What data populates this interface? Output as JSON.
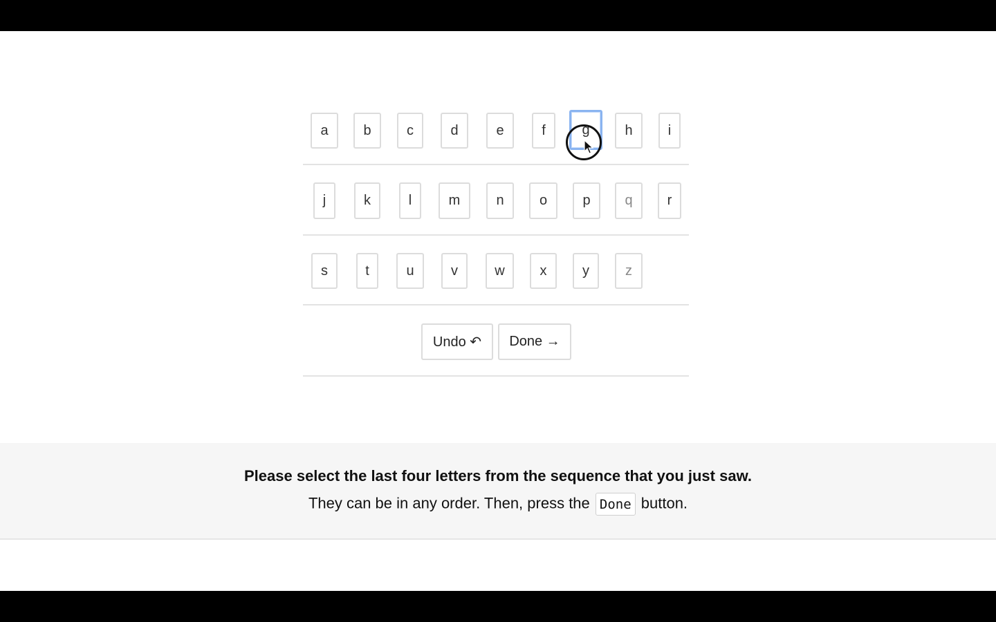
{
  "keyboard": {
    "row1": [
      "a",
      "b",
      "c",
      "d",
      "e",
      "f",
      "g",
      "h",
      "i"
    ],
    "row2": [
      "j",
      "k",
      "l",
      "m",
      "n",
      "o",
      "p",
      "q",
      "r"
    ],
    "row3": [
      "s",
      "t",
      "u",
      "v",
      "w",
      "x",
      "y",
      "z"
    ],
    "selected_key": "g"
  },
  "actions": {
    "undo_label": "Undo ↶",
    "done_label": "Done →"
  },
  "instructions": {
    "line1": "Please select the last four letters from the sequence that you just saw.",
    "line2_before": "They can be in any order. Then, press the ",
    "line2_code": "Done",
    "line2_after": " button."
  }
}
